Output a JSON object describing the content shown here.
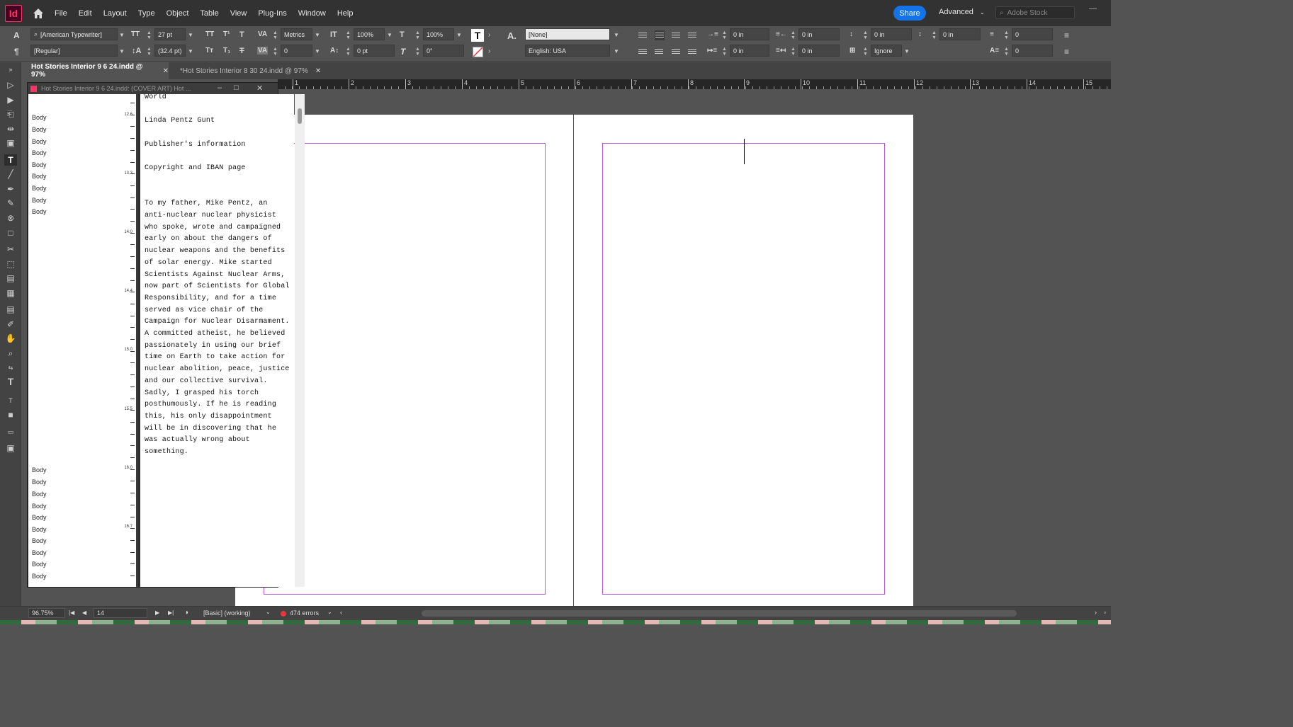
{
  "app": {
    "logo": "Id",
    "menu": [
      "File",
      "Edit",
      "Layout",
      "Type",
      "Object",
      "Table",
      "View",
      "Plug-Ins",
      "Window",
      "Help"
    ],
    "share_label": "Share",
    "workspace": "Advanced",
    "stock_placeholder": "Adobe Stock",
    "window_controls": [
      "—"
    ]
  },
  "control_panel": {
    "font_family": "[American Typewriter]",
    "font_style": "[Regular]",
    "font_size": "27 pt",
    "leading": "(32.4 pt)",
    "kerning": "Metrics",
    "tracking": "0",
    "vertical_scale": "100%",
    "horizontal_scale": "100%",
    "baseline_shift": "0 pt",
    "skew": "0°",
    "char_style": "[None]",
    "language": "English: USA",
    "left_indent": "0 in",
    "first_line_indent": "0 in",
    "right_indent": "0 in",
    "last_line_indent": "0 in",
    "space_before": "0 in",
    "space_after": "0 in",
    "align_to_grid": "Ignore",
    "drop_cap_lines": "0",
    "drop_cap_chars": "0"
  },
  "tabs": [
    {
      "label": "Hot Stories Interior 9 6 24.indd @ 97%",
      "active": true
    },
    {
      "label": "*Hot Stories Interior 8 30  24.indd @ 97%",
      "active": false
    }
  ],
  "ruler": {
    "labels": [
      "1",
      "2",
      "3",
      "4",
      "5",
      "6",
      "7",
      "8",
      "9",
      "10",
      "11",
      "12",
      "13",
      "14",
      "15"
    ]
  },
  "story_editor": {
    "title": "Hot Stories Interior 9 6 24.indd: (COVER ART)  Hot ...",
    "style_labels_top": [
      "Body",
      "Body",
      "Body",
      "Body",
      "Body",
      "Body",
      "Body",
      "Body",
      "Body",
      "Body"
    ],
    "style_labels_bottom": [
      "Body",
      "Body",
      "Body",
      "Body",
      "Body",
      "Body",
      "Body",
      "Body",
      "Body",
      "Body"
    ],
    "depth_marks": [
      "12.6",
      "13.3",
      "14.0",
      "14.4",
      "15.0",
      "15.5",
      "16.0",
      "16.7"
    ],
    "lines": [
      "World",
      "",
      "Linda Pentz Gunt",
      "",
      "Publisher's information",
      "",
      "Copyright and IBAN page",
      "",
      "",
      "To my father, Mike Pentz, an",
      "anti-nuclear nuclear physicist",
      "who spoke, wrote and campaigned",
      "early on about the dangers of",
      "nuclear weapons and the benefits",
      "of solar energy. Mike started",
      "Scientists Against Nuclear Arms,",
      "now part of Scientists for Global",
      "Responsibility, and for a time",
      "served as vice chair of the",
      "Campaign for Nuclear Disarmament.",
      "A committed atheist, he believed",
      "passionately in using our brief",
      "time on Earth to take action for",
      "nuclear abolition, peace, justice",
      "and our collective survival.",
      "Sadly, I grasped his torch",
      "posthumously. If he is reading",
      "this, his only disappointment",
      "will be in discovering that he",
      "was actually wrong about",
      "something."
    ]
  },
  "status_bar": {
    "zoom": "96.75%",
    "page": "14",
    "preflight_profile": "[Basic] (working)",
    "errors": "474 errors"
  },
  "colors": {
    "accent": "#1473e6",
    "margin_guide": "#b65bd6",
    "error": "#e5383b",
    "logo": "#ff3366"
  }
}
